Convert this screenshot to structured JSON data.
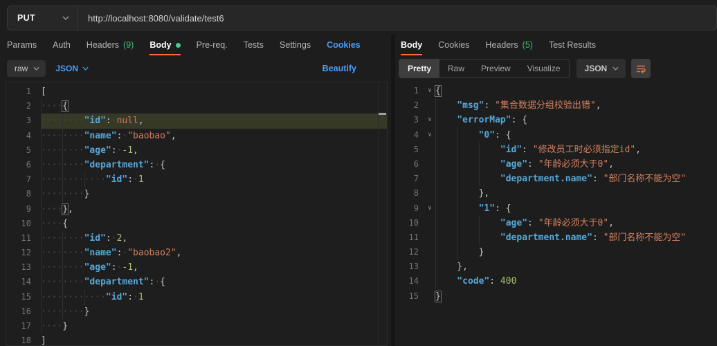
{
  "colors": {
    "accent_orange": "#ff6c37",
    "link_blue": "#4a9df8",
    "count_green": "#3fbf6f",
    "modified_dot_green": "#49cc90",
    "line_highlight": "#373927",
    "token_key_blue": "#56a8d8",
    "token_string_orange": "#d4805e",
    "token_number_green": "#a5bf72"
  },
  "request_bar": {
    "method": "PUT",
    "url": "http://localhost:8080/validate/test6"
  },
  "request_tabs": {
    "items": [
      {
        "label": "Params"
      },
      {
        "label": "Auth"
      },
      {
        "label": "Headers",
        "count": "(9)"
      },
      {
        "label": "Body",
        "active": true,
        "modified": true
      },
      {
        "label": "Pre-req."
      },
      {
        "label": "Tests"
      },
      {
        "label": "Settings"
      }
    ],
    "cookies_link": "Cookies"
  },
  "body_toolbar": {
    "type": "raw",
    "language": "JSON",
    "beautify_link": "Beautify"
  },
  "response_tabs": {
    "items": [
      {
        "label": "Body",
        "active": true
      },
      {
        "label": "Cookies"
      },
      {
        "label": "Headers",
        "count": "(5)"
      },
      {
        "label": "Test Results"
      }
    ]
  },
  "response_toolbar": {
    "views": [
      {
        "label": "Pretty",
        "active": true
      },
      {
        "label": "Raw"
      },
      {
        "label": "Preview"
      },
      {
        "label": "Visualize"
      }
    ],
    "language": "JSON",
    "wrap_icon": "wrap-text-icon"
  },
  "request_editor": {
    "lines": [
      {
        "n": 1,
        "t": [
          [
            "p",
            "["
          ]
        ]
      },
      {
        "n": 2,
        "t": [
          [
            "w",
            4
          ],
          [
            "b",
            "{"
          ]
        ]
      },
      {
        "n": 3,
        "hl": true,
        "t": [
          [
            "w",
            8
          ],
          [
            "k",
            "\"id\""
          ],
          [
            "p",
            ":"
          ],
          [
            "w",
            1
          ],
          [
            "c",
            "null"
          ],
          [
            "p",
            ","
          ]
        ]
      },
      {
        "n": 4,
        "t": [
          [
            "w",
            8
          ],
          [
            "k",
            "\"name\""
          ],
          [
            "p",
            ":"
          ],
          [
            "w",
            1
          ],
          [
            "s",
            "\"baobao\""
          ],
          [
            "p",
            ","
          ]
        ]
      },
      {
        "n": 5,
        "t": [
          [
            "w",
            8
          ],
          [
            "k",
            "\"age\""
          ],
          [
            "p",
            ":"
          ],
          [
            "w",
            1
          ],
          [
            "n",
            "-1"
          ],
          [
            "p",
            ","
          ]
        ]
      },
      {
        "n": 6,
        "t": [
          [
            "w",
            8
          ],
          [
            "k",
            "\"department\""
          ],
          [
            "p",
            ":"
          ],
          [
            "w",
            1
          ],
          [
            "p",
            "{"
          ]
        ]
      },
      {
        "n": 7,
        "t": [
          [
            "w",
            12
          ],
          [
            "k",
            "\"id\""
          ],
          [
            "p",
            ":"
          ],
          [
            "w",
            1
          ],
          [
            "n",
            "1"
          ]
        ]
      },
      {
        "n": 8,
        "t": [
          [
            "w",
            8
          ],
          [
            "p",
            "}"
          ]
        ]
      },
      {
        "n": 9,
        "t": [
          [
            "w",
            4
          ],
          [
            "b",
            "}"
          ],
          [
            "p",
            ","
          ]
        ]
      },
      {
        "n": 10,
        "t": [
          [
            "w",
            4
          ],
          [
            "p",
            "{"
          ]
        ]
      },
      {
        "n": 11,
        "t": [
          [
            "w",
            8
          ],
          [
            "k",
            "\"id\""
          ],
          [
            "p",
            ":"
          ],
          [
            "w",
            1
          ],
          [
            "n",
            "2"
          ],
          [
            "p",
            ","
          ]
        ]
      },
      {
        "n": 12,
        "t": [
          [
            "w",
            8
          ],
          [
            "k",
            "\"name\""
          ],
          [
            "p",
            ":"
          ],
          [
            "w",
            1
          ],
          [
            "s",
            "\"baobao2\""
          ],
          [
            "p",
            ","
          ]
        ]
      },
      {
        "n": 13,
        "t": [
          [
            "w",
            8
          ],
          [
            "k",
            "\"age\""
          ],
          [
            "p",
            ":"
          ],
          [
            "w",
            1
          ],
          [
            "n",
            "-1"
          ],
          [
            "p",
            ","
          ]
        ]
      },
      {
        "n": 14,
        "t": [
          [
            "w",
            8
          ],
          [
            "k",
            "\"department\""
          ],
          [
            "p",
            ":"
          ],
          [
            "w",
            1
          ],
          [
            "p",
            "{"
          ]
        ]
      },
      {
        "n": 15,
        "t": [
          [
            "w",
            12
          ],
          [
            "k",
            "\"id\""
          ],
          [
            "p",
            ":"
          ],
          [
            "w",
            1
          ],
          [
            "n",
            "1"
          ]
        ]
      },
      {
        "n": 16,
        "t": [
          [
            "w",
            8
          ],
          [
            "p",
            "}"
          ]
        ]
      },
      {
        "n": 17,
        "t": [
          [
            "w",
            4
          ],
          [
            "p",
            "}"
          ]
        ]
      },
      {
        "n": 18,
        "t": [
          [
            "p",
            "]"
          ]
        ]
      }
    ]
  },
  "response_editor": {
    "lines": [
      {
        "n": 1,
        "fold": true,
        "t": [
          [
            "b",
            "{"
          ]
        ]
      },
      {
        "n": 2,
        "t": [
          [
            "w",
            4
          ],
          [
            "k",
            "\"msg\""
          ],
          [
            "p",
            ":"
          ],
          [
            "w",
            1
          ],
          [
            "s",
            "\"集合数据分组校验出错\""
          ],
          [
            "p",
            ","
          ]
        ]
      },
      {
        "n": 3,
        "fold": true,
        "t": [
          [
            "w",
            4
          ],
          [
            "k",
            "\"errorMap\""
          ],
          [
            "p",
            ":"
          ],
          [
            "w",
            1
          ],
          [
            "p",
            "{"
          ]
        ]
      },
      {
        "n": 4,
        "fold": true,
        "t": [
          [
            "w",
            8
          ],
          [
            "k",
            "\"0\""
          ],
          [
            "p",
            ":"
          ],
          [
            "w",
            1
          ],
          [
            "p",
            "{"
          ]
        ]
      },
      {
        "n": 5,
        "t": [
          [
            "w",
            12
          ],
          [
            "k",
            "\"id\""
          ],
          [
            "p",
            ":"
          ],
          [
            "w",
            1
          ],
          [
            "s",
            "\"修改员工时必须指定id\""
          ],
          [
            "p",
            ","
          ]
        ]
      },
      {
        "n": 6,
        "t": [
          [
            "w",
            12
          ],
          [
            "k",
            "\"age\""
          ],
          [
            "p",
            ":"
          ],
          [
            "w",
            1
          ],
          [
            "s",
            "\"年龄必须大于0\""
          ],
          [
            "p",
            ","
          ]
        ]
      },
      {
        "n": 7,
        "t": [
          [
            "w",
            12
          ],
          [
            "k",
            "\"department.name\""
          ],
          [
            "p",
            ":"
          ],
          [
            "w",
            1
          ],
          [
            "s",
            "\"部门名称不能为空\""
          ]
        ]
      },
      {
        "n": 8,
        "t": [
          [
            "w",
            8
          ],
          [
            "p",
            "},"
          ]
        ]
      },
      {
        "n": 9,
        "fold": true,
        "t": [
          [
            "w",
            8
          ],
          [
            "k",
            "\"1\""
          ],
          [
            "p",
            ":"
          ],
          [
            "w",
            1
          ],
          [
            "p",
            "{"
          ]
        ]
      },
      {
        "n": 10,
        "t": [
          [
            "w",
            12
          ],
          [
            "k",
            "\"age\""
          ],
          [
            "p",
            ":"
          ],
          [
            "w",
            1
          ],
          [
            "s",
            "\"年龄必须大于0\""
          ],
          [
            "p",
            ","
          ]
        ]
      },
      {
        "n": 11,
        "t": [
          [
            "w",
            12
          ],
          [
            "k",
            "\"department.name\""
          ],
          [
            "p",
            ":"
          ],
          [
            "w",
            1
          ],
          [
            "s",
            "\"部门名称不能为空\""
          ]
        ]
      },
      {
        "n": 12,
        "t": [
          [
            "w",
            8
          ],
          [
            "p",
            "}"
          ]
        ]
      },
      {
        "n": 13,
        "t": [
          [
            "w",
            4
          ],
          [
            "p",
            "},"
          ]
        ]
      },
      {
        "n": 14,
        "t": [
          [
            "w",
            4
          ],
          [
            "k",
            "\"code\""
          ],
          [
            "p",
            ":"
          ],
          [
            "w",
            1
          ],
          [
            "n",
            "400"
          ]
        ]
      },
      {
        "n": 15,
        "t": [
          [
            "b",
            "}"
          ]
        ]
      }
    ]
  }
}
